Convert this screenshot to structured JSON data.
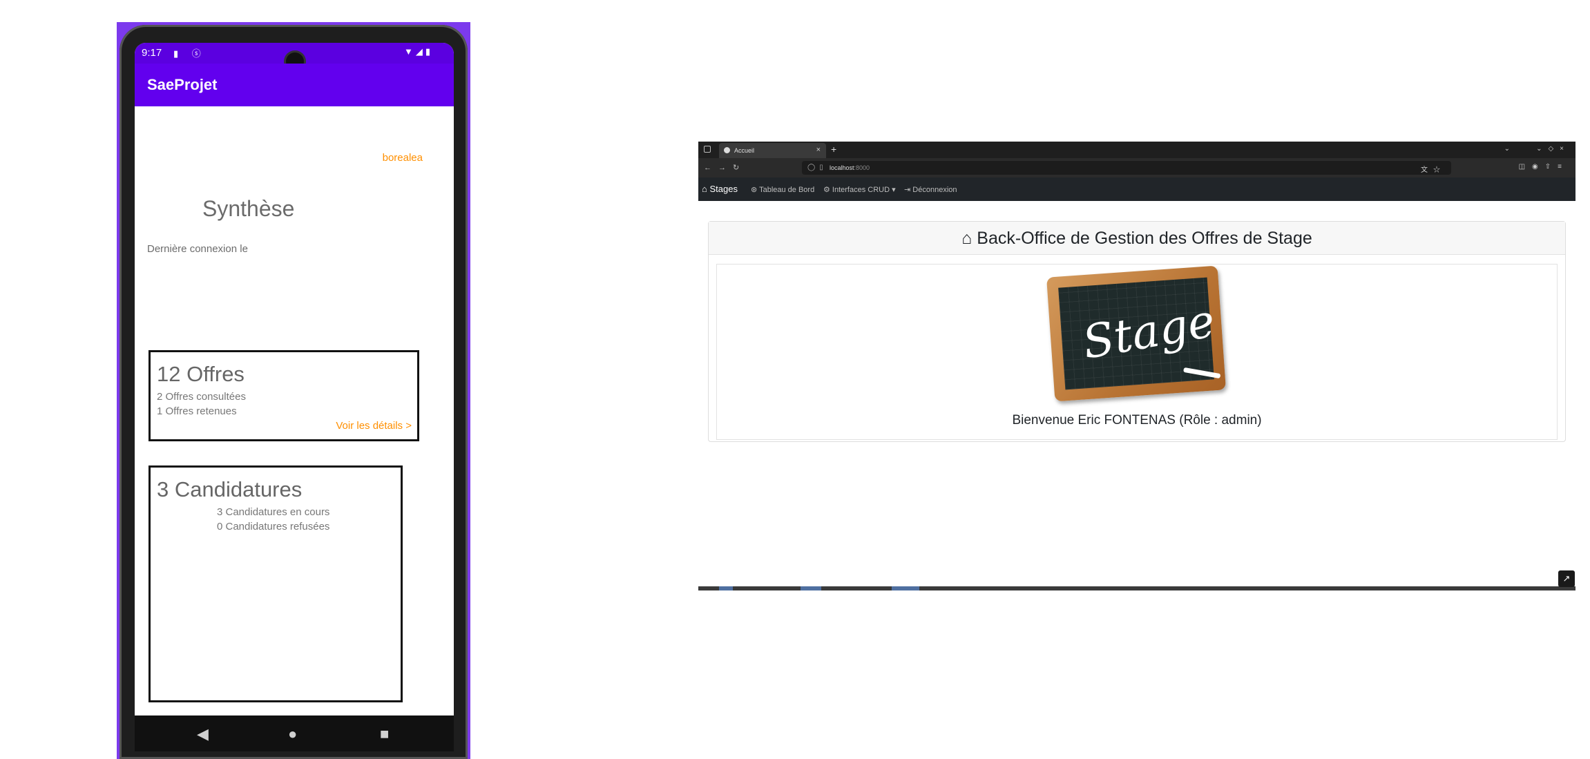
{
  "phone": {
    "status": {
      "time": "9:17"
    },
    "app_title": "SaeProjet",
    "user": "borealea",
    "heading": "Synthèse",
    "last_login_label": "Dernière connexion le",
    "offres_card": {
      "title": "12 Offres",
      "consulted": "2 Offres consultées",
      "retained": "1 Offres retenues",
      "details_link": "Voir les détails >"
    },
    "candidatures_card": {
      "title": "3 Candidatures",
      "in_progress": "3 Candidatures en cours",
      "refused": "0 Candidatures refusées"
    },
    "nav": {
      "back": "◀",
      "home": "●",
      "recents": "■"
    }
  },
  "browser": {
    "tab_title": "Accueil",
    "url": "localhost",
    "url_port": ":8000",
    "site_nav": {
      "brand": "Stages",
      "links": [
        "Tableau de Bord",
        "Interfaces CRUD",
        "Déconnexion"
      ]
    },
    "panel_title": "Back-Office de Gestion des Offres de Stage",
    "slate_text": "Stage",
    "welcome": "Bienvenue Eric FONTENAS (Rôle : admin)"
  },
  "colors": {
    "phone_frame": "#7c3aed",
    "app_bar": "#6200ee",
    "accent_orange": "#ff8f00",
    "browser_nav": "#212529"
  }
}
